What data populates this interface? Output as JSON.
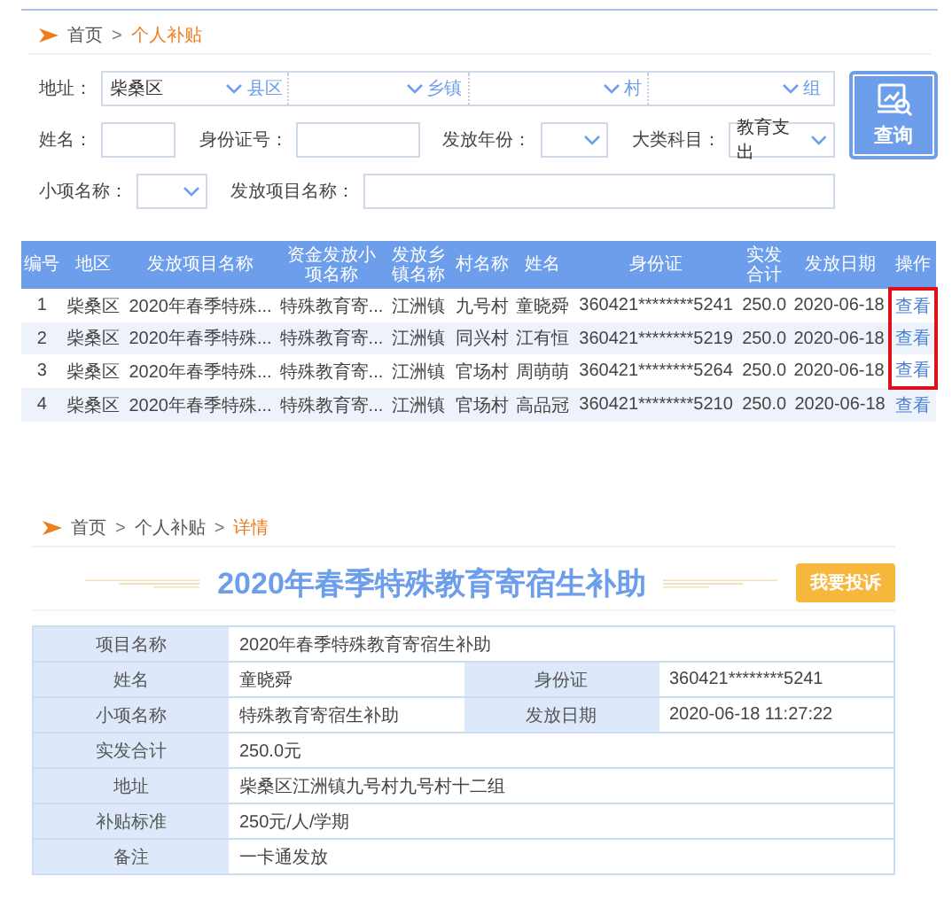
{
  "list_page": {
    "breadcrumb": {
      "separator": ">",
      "items": [
        {
          "label": "首页",
          "current": false
        },
        {
          "label": "个人补贴",
          "current": true
        }
      ]
    },
    "search": {
      "address_label": "地址：",
      "address": [
        {
          "value": "柴桑区",
          "unit": "县区"
        },
        {
          "unit": "乡镇"
        },
        {
          "unit": "村"
        },
        {
          "unit": "组"
        }
      ],
      "rows": [
        [
          {
            "kind": "text",
            "label": "姓名："
          },
          {
            "kind": "text",
            "label": "身份证号："
          },
          {
            "kind": "select",
            "label": "发放年份："
          },
          {
            "kind": "select",
            "label": "大类科目：",
            "value": "教育支出"
          }
        ],
        [
          {
            "kind": "select",
            "label": "小项名称："
          },
          {
            "kind": "wide",
            "label": "发放项目名称："
          }
        ]
      ],
      "button": "查询"
    },
    "table": {
      "columns": [
        "编号",
        "地区",
        "发放项目名称",
        "资金发放小项名称",
        "发放乡镇名称",
        "村名称",
        "姓名",
        "身份证",
        "实发合计",
        "发放日期",
        "操作"
      ],
      "rows": [
        {
          "cells": [
            "1",
            "柴桑区",
            "2020年春季特殊...",
            "特殊教育寄...",
            "江洲镇",
            "九号村",
            "童晓舜",
            "360421********5241",
            "250.0",
            "2020-06-18"
          ],
          "action": "查看",
          "highlighted": true
        },
        {
          "cells": [
            "2",
            "柴桑区",
            "2020年春季特殊...",
            "特殊教育寄...",
            "江洲镇",
            "同兴村",
            "江有恒",
            "360421********5219",
            "250.0",
            "2020-06-18"
          ],
          "action": "查看",
          "highlighted": true
        },
        {
          "cells": [
            "3",
            "柴桑区",
            "2020年春季特殊...",
            "特殊教育寄...",
            "江洲镇",
            "官场村",
            "周萌萌",
            "360421********5264",
            "250.0",
            "2020-06-18"
          ],
          "action": "查看",
          "highlighted": true
        },
        {
          "cells": [
            "4",
            "柴桑区",
            "2020年春季特殊...",
            "特殊教育寄...",
            "江洲镇",
            "官场村",
            "高品冠",
            "360421********5210",
            "250.0",
            "2020-06-18"
          ],
          "action": "查看",
          "highlighted": false
        }
      ]
    }
  },
  "detail_page": {
    "breadcrumb": {
      "separator": ">",
      "items": [
        {
          "label": "首页",
          "current": false
        },
        {
          "label": "个人补贴",
          "current": false
        },
        {
          "label": "详情",
          "current": true
        }
      ]
    },
    "title": "2020年春季特殊教育寄宿生补助",
    "complaint_button": "我要投诉",
    "rows": [
      [
        {
          "label": "项目名称",
          "value": "2020年春季特殊教育寄宿生补助"
        }
      ],
      [
        {
          "label": "姓名",
          "value": "童晓舜"
        },
        {
          "label": "身份证",
          "value": "360421********5241"
        }
      ],
      [
        {
          "label": "小项名称",
          "value": "特殊教育寄宿生补助"
        },
        {
          "label": "发放日期",
          "value": "2020-06-18 11:27:22"
        }
      ],
      [
        {
          "label": "实发合计",
          "value": "250.0元"
        }
      ],
      [
        {
          "label": "地址",
          "value": "柴桑区江洲镇九号村九号村十二组"
        }
      ],
      [
        {
          "label": "补贴标准",
          "value": "250元/人/学期"
        }
      ],
      [
        {
          "label": "备注",
          "value": "一卡通发放"
        }
      ]
    ]
  }
}
